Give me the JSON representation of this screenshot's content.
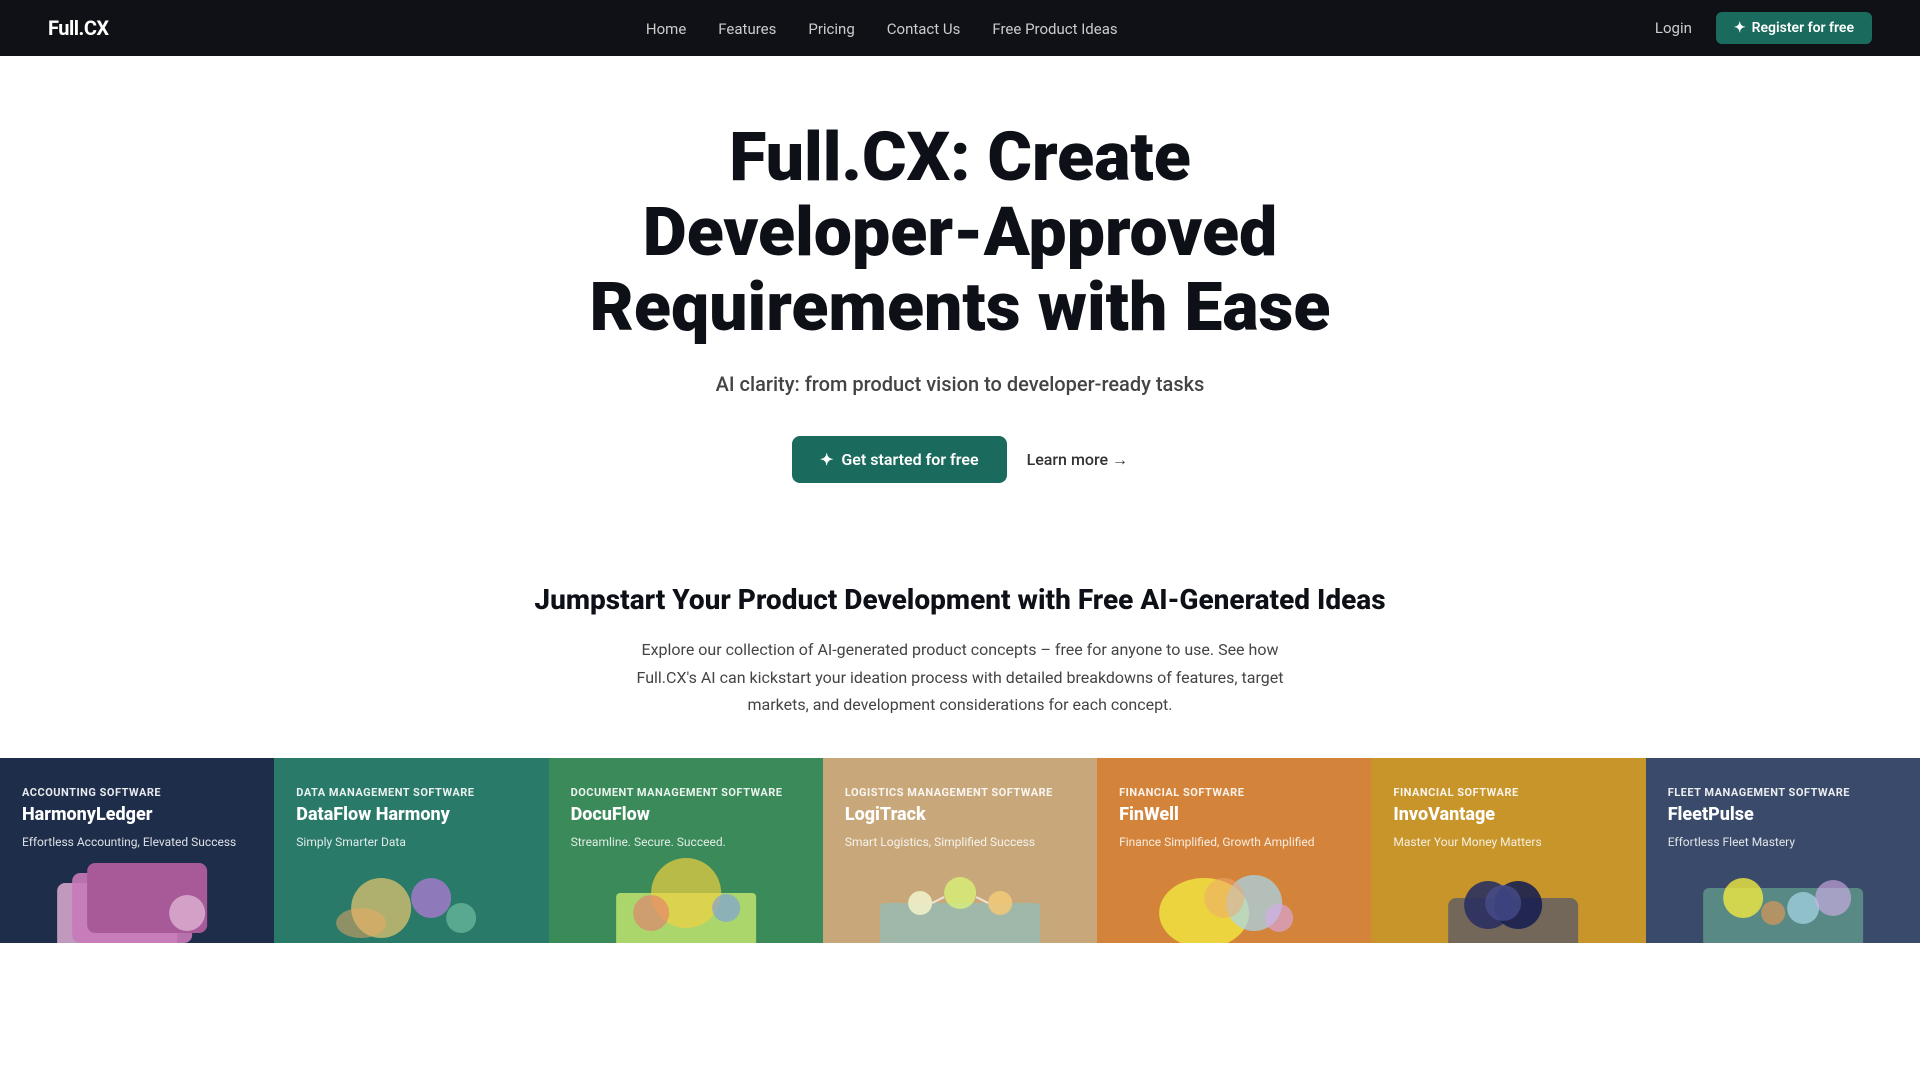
{
  "nav": {
    "logo": "Full.CX",
    "links": [
      {
        "label": "Home",
        "href": "#"
      },
      {
        "label": "Features",
        "href": "#"
      },
      {
        "label": "Pricing",
        "href": "#"
      },
      {
        "label": "Contact Us",
        "href": "#"
      },
      {
        "label": "Free Product Ideas",
        "href": "#"
      }
    ],
    "login_label": "Login",
    "register_label": "Register for free"
  },
  "hero": {
    "heading": "Full.CX: Create Developer-Approved Requirements with Ease",
    "subtitle": "AI clarity: from product vision to developer-ready tasks",
    "cta_primary": "Get started for free",
    "cta_secondary": "Learn more →"
  },
  "jumpstart": {
    "heading": "Jumpstart Your Product Development with Free AI-Generated Ideas",
    "body": "Explore our collection of AI-generated product concepts – free for anyone to use. See how Full.CX's AI can kickstart your ideation process with detailed breakdowns of features, target markets, and development considerations for each concept."
  },
  "cards": [
    {
      "category": "Accounting Software",
      "title": "HarmonyLedger",
      "subtitle": "Effortless Accounting, Elevated Success",
      "color": "dark-blue"
    },
    {
      "category": "Data Management Software",
      "title": "DataFlow Harmony",
      "subtitle": "Simply Smarter Data",
      "color": "teal"
    },
    {
      "category": "Document Management Software",
      "title": "DocuFlow",
      "subtitle": "Streamline. Secure. Succeed.",
      "color": "green"
    },
    {
      "category": "Logistics Management Software",
      "title": "LogiTrack",
      "subtitle": "Smart Logistics, Simplified Success",
      "color": "sand"
    },
    {
      "category": "Financial Software",
      "title": "FinWell",
      "subtitle": "Finance Simplified, Growth Amplified",
      "color": "orange"
    },
    {
      "category": "Financial Software",
      "title": "InvoVantage",
      "subtitle": "Master Your Money Matters",
      "color": "amber"
    },
    {
      "category": "Fleet Management Software",
      "title": "FleetPulse",
      "subtitle": "Effortless Fleet Mastery",
      "color": "slate"
    }
  ]
}
